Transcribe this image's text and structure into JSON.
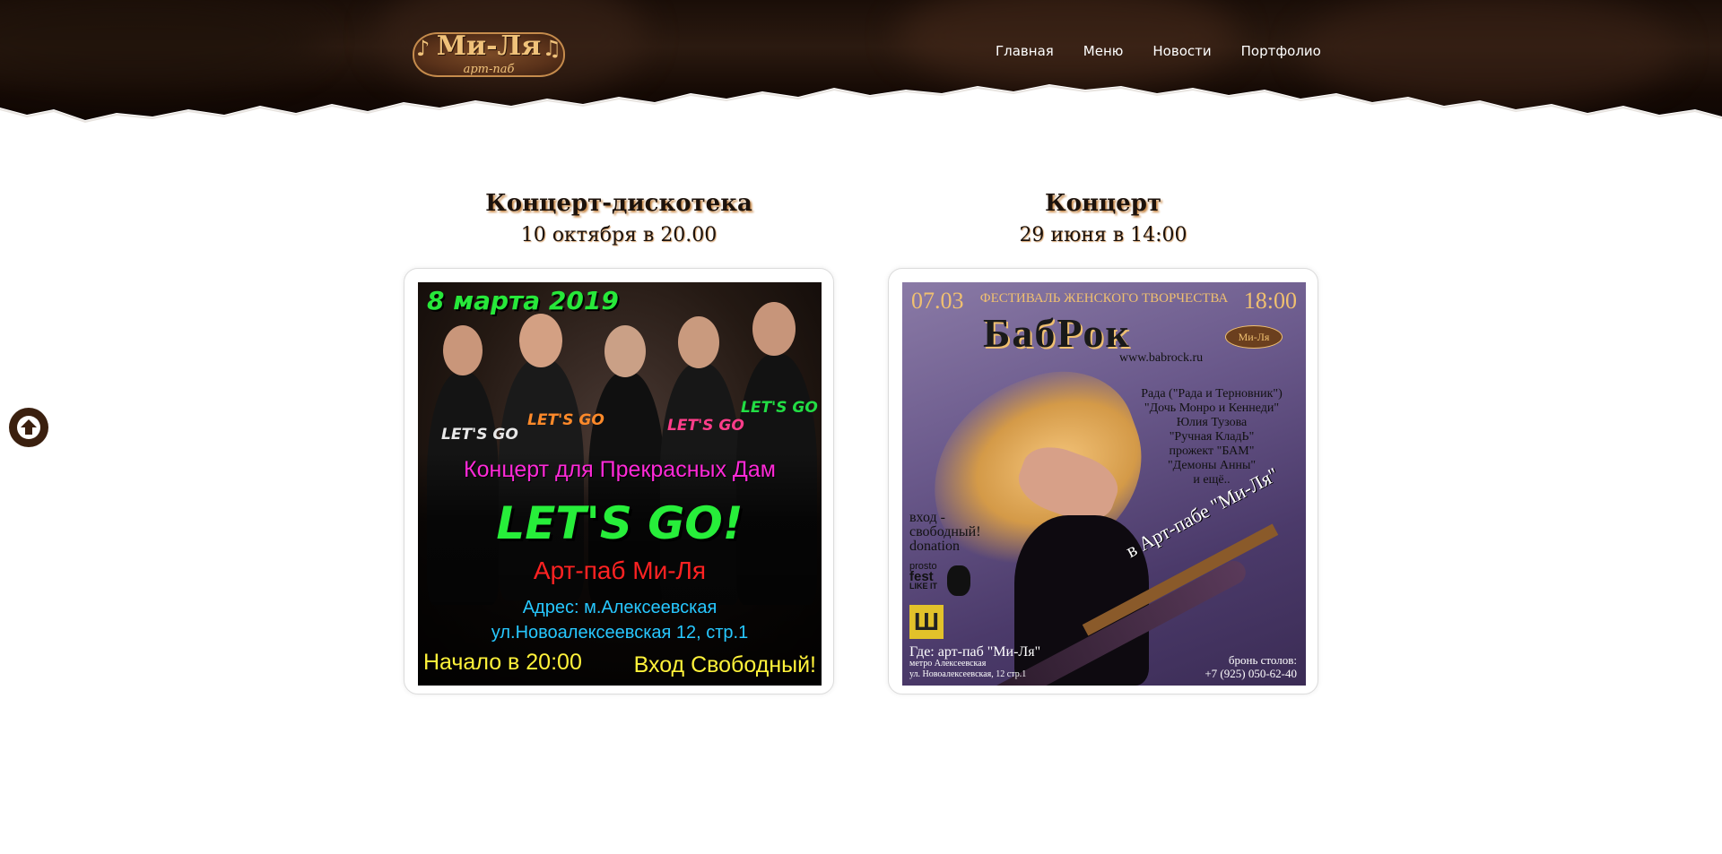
{
  "header": {
    "logo": {
      "main": "Ми-Ля",
      "sub": "арт-паб"
    },
    "nav": [
      "Главная",
      "Меню",
      "Новости",
      "Портфолио"
    ]
  },
  "events": [
    {
      "title": "Концерт-дискотека",
      "date": "10 октября в 20.00",
      "poster": {
        "date_line": "8 марта 2019",
        "subtitle": "Концерт для Прекрасных Дам",
        "band": "LET'S GO!",
        "venue": "Арт-паб Ми-Ля",
        "address1": "Адрес: м.Алексеевская",
        "address2": "ул.Новоалексеевская 12, стр.1",
        "start": "Начало в 20:00",
        "entry": "Вход Свободный!",
        "shirt_text": [
          "LET'S GO",
          "LET'S GO",
          "LET'S GO",
          "LET'S GO"
        ]
      }
    },
    {
      "title": "Концерт",
      "date": "29 июня в 14:00",
      "poster": {
        "date": "07.03",
        "festival": "ФЕСТИВАЛЬ ЖЕНСКОГО ТВОРЧЕСТВА",
        "time": "18:00",
        "name": "БабРок",
        "site": "www.babrock.ru",
        "lineup": [
          "Рада (\"Рада и Терновник\")",
          "\"Дочь Монро и Кеннеди\"",
          "Юлия Тузова",
          "\"Ручная КладЬ\"",
          "прожект \"БАМ\"",
          "\"Демоны Анны\"",
          "и ещё.."
        ],
        "diagonal": "в Арт-пабе \"Ми-Ля\"",
        "entry": [
          "вход -",
          "свободный!",
          "donation"
        ],
        "sponsor1": [
          "prosto",
          "fest",
          "LIKE IT"
        ],
        "where": "Где: арт-паб \"Ми-Ля\"",
        "metro": "метро Алексеевская",
        "street": "ул. Новоалексеевская, 12 стр.1",
        "booking_label": "бронь столов:",
        "booking_phone": "+7 (925) 050-62-40",
        "mini_logo": "Ми-Ля"
      }
    }
  ],
  "colors": {
    "header_bg": "#1a0e08",
    "title_shadow": "#c98a4a",
    "scroll_button": "#3b200f"
  },
  "icons": {
    "scroll_top": "arrow-up-circle-icon",
    "logo_note": "music-note-icon"
  }
}
